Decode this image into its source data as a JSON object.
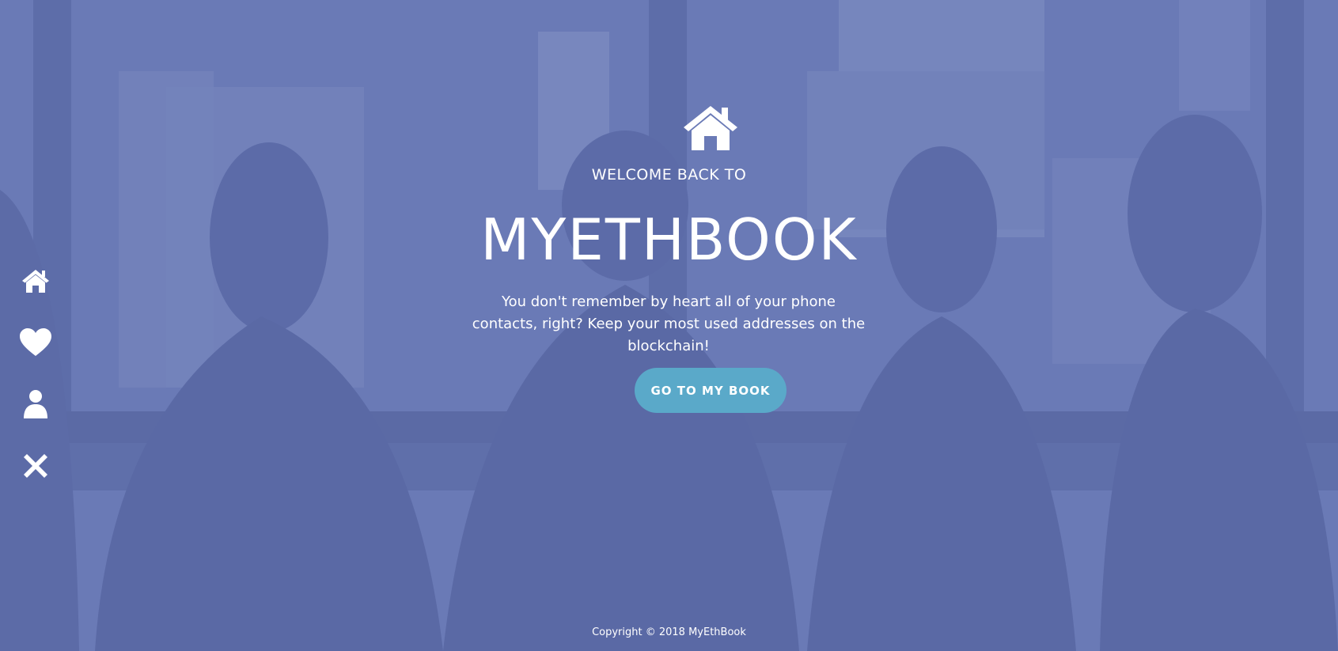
{
  "sidebar": {
    "items": [
      {
        "icon": "home-icon",
        "label": "Home"
      },
      {
        "icon": "heart-icon",
        "label": "Favorites"
      },
      {
        "icon": "user-icon",
        "label": "Profile"
      },
      {
        "icon": "close-icon",
        "label": "Logout"
      }
    ]
  },
  "hero": {
    "icon": "home-icon",
    "welcome": "WELCOME BACK TO",
    "title": "MYETHBOOK",
    "tagline": "You don't remember by heart all of your phone contacts, right? Keep your most used addresses on the blockchain!",
    "cta_label": "GO TO MY BOOK"
  },
  "footer": {
    "copyright": "Copyright © 2018 MyEthBook"
  },
  "colors": {
    "overlay": "#6877b0",
    "button": "#5aa9c9",
    "text": "#ffffff"
  }
}
